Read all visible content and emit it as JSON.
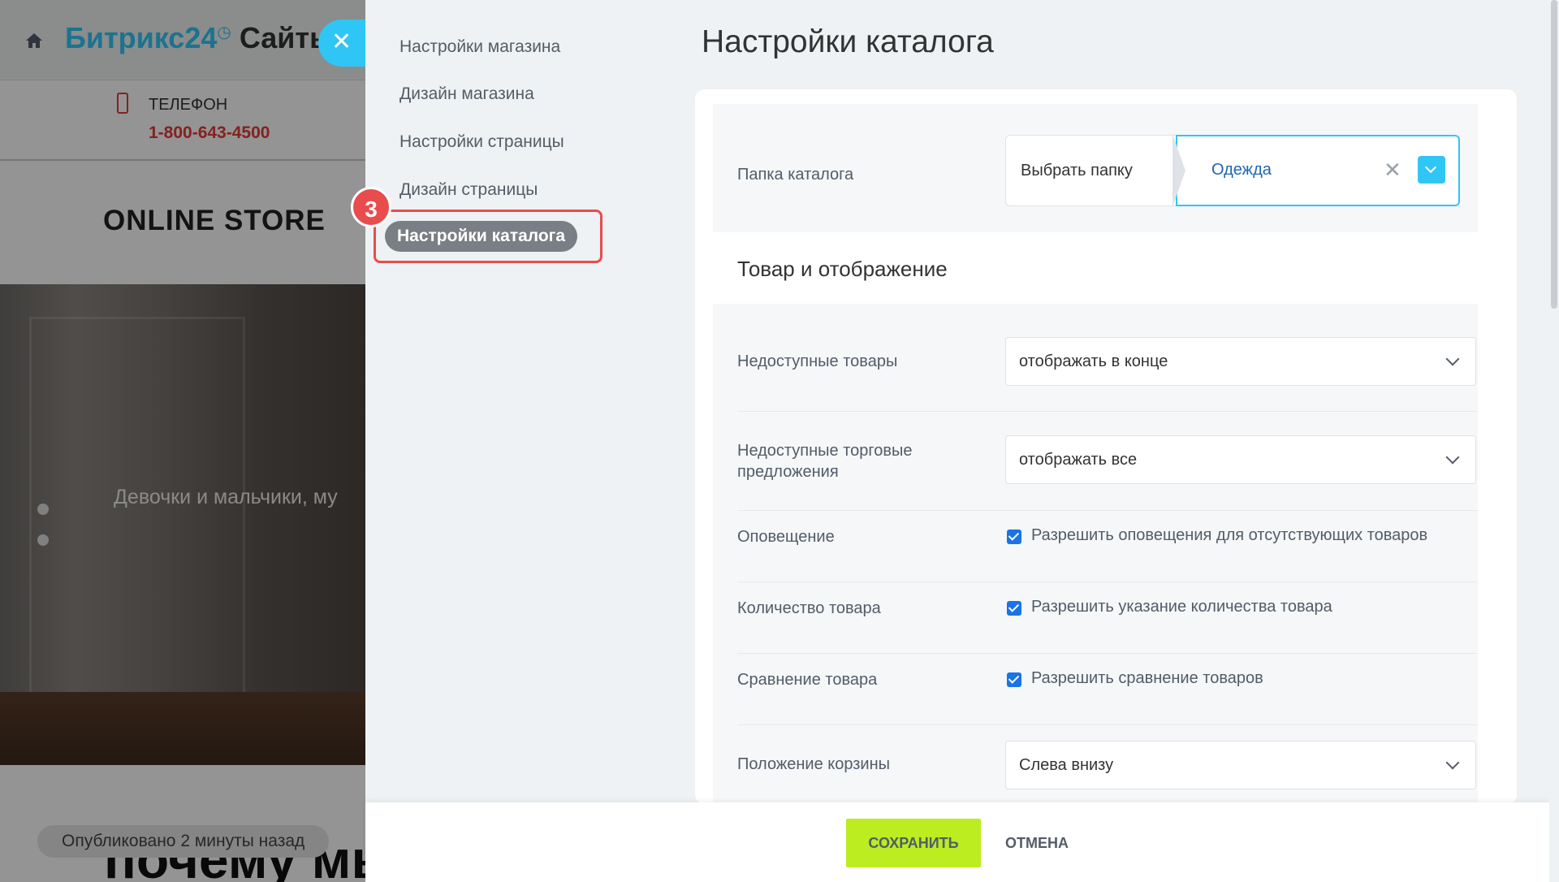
{
  "site": {
    "brand_main": "Битрикс24",
    "brand_clock": "◷",
    "brand_second": "Сайты",
    "phone_label": "ТЕЛЕФОН",
    "phone_number": "1-800-643-4500",
    "store_title": "ONLINE STORE",
    "hero_text": "Девочки и мальчики, му",
    "why_text": "почему мы",
    "published": "Опубликовано 2 минуты назад",
    "close_symbol": "✕"
  },
  "nav": {
    "items": [
      {
        "label": "Настройки магазина"
      },
      {
        "label": "Дизайн магазина"
      },
      {
        "label": "Настройки страницы"
      },
      {
        "label": "Дизайн страницы"
      },
      {
        "label": "Настройки каталога"
      }
    ],
    "active_index": 4,
    "step_badge": "3"
  },
  "page": {
    "title": "Настройки каталога"
  },
  "form": {
    "folder": {
      "label": "Папка каталога",
      "choose_label": "Выбрать папку",
      "value": "Одежда",
      "clear_symbol": "✕"
    },
    "section_title": "Товар и отображение",
    "unavailable_products": {
      "label": "Недоступные товары",
      "value": "отображать в конце"
    },
    "unavailable_offers": {
      "label": "Недоступные торговые предложения",
      "value": "отображать все"
    },
    "notification": {
      "label": "Оповещение",
      "checkbox_label": "Разрешить оповещения для отсутствующих товаров",
      "checked": true
    },
    "quantity": {
      "label": "Количество товара",
      "checkbox_label": "Разрешить указание количества товара",
      "checked": true
    },
    "comparison": {
      "label": "Сравнение товара",
      "checkbox_label": "Разрешить сравнение товаров",
      "checked": true
    },
    "cart_position": {
      "label": "Положение корзины",
      "value": "Слева внизу"
    }
  },
  "footer": {
    "save_label": "СОХРАНИТЬ",
    "cancel_label": "ОТМЕНА"
  },
  "colors": {
    "accent": "#2fc6f6",
    "save": "#bbed21",
    "highlight": "#e84c4c",
    "checkbox": "#1a73e8"
  }
}
